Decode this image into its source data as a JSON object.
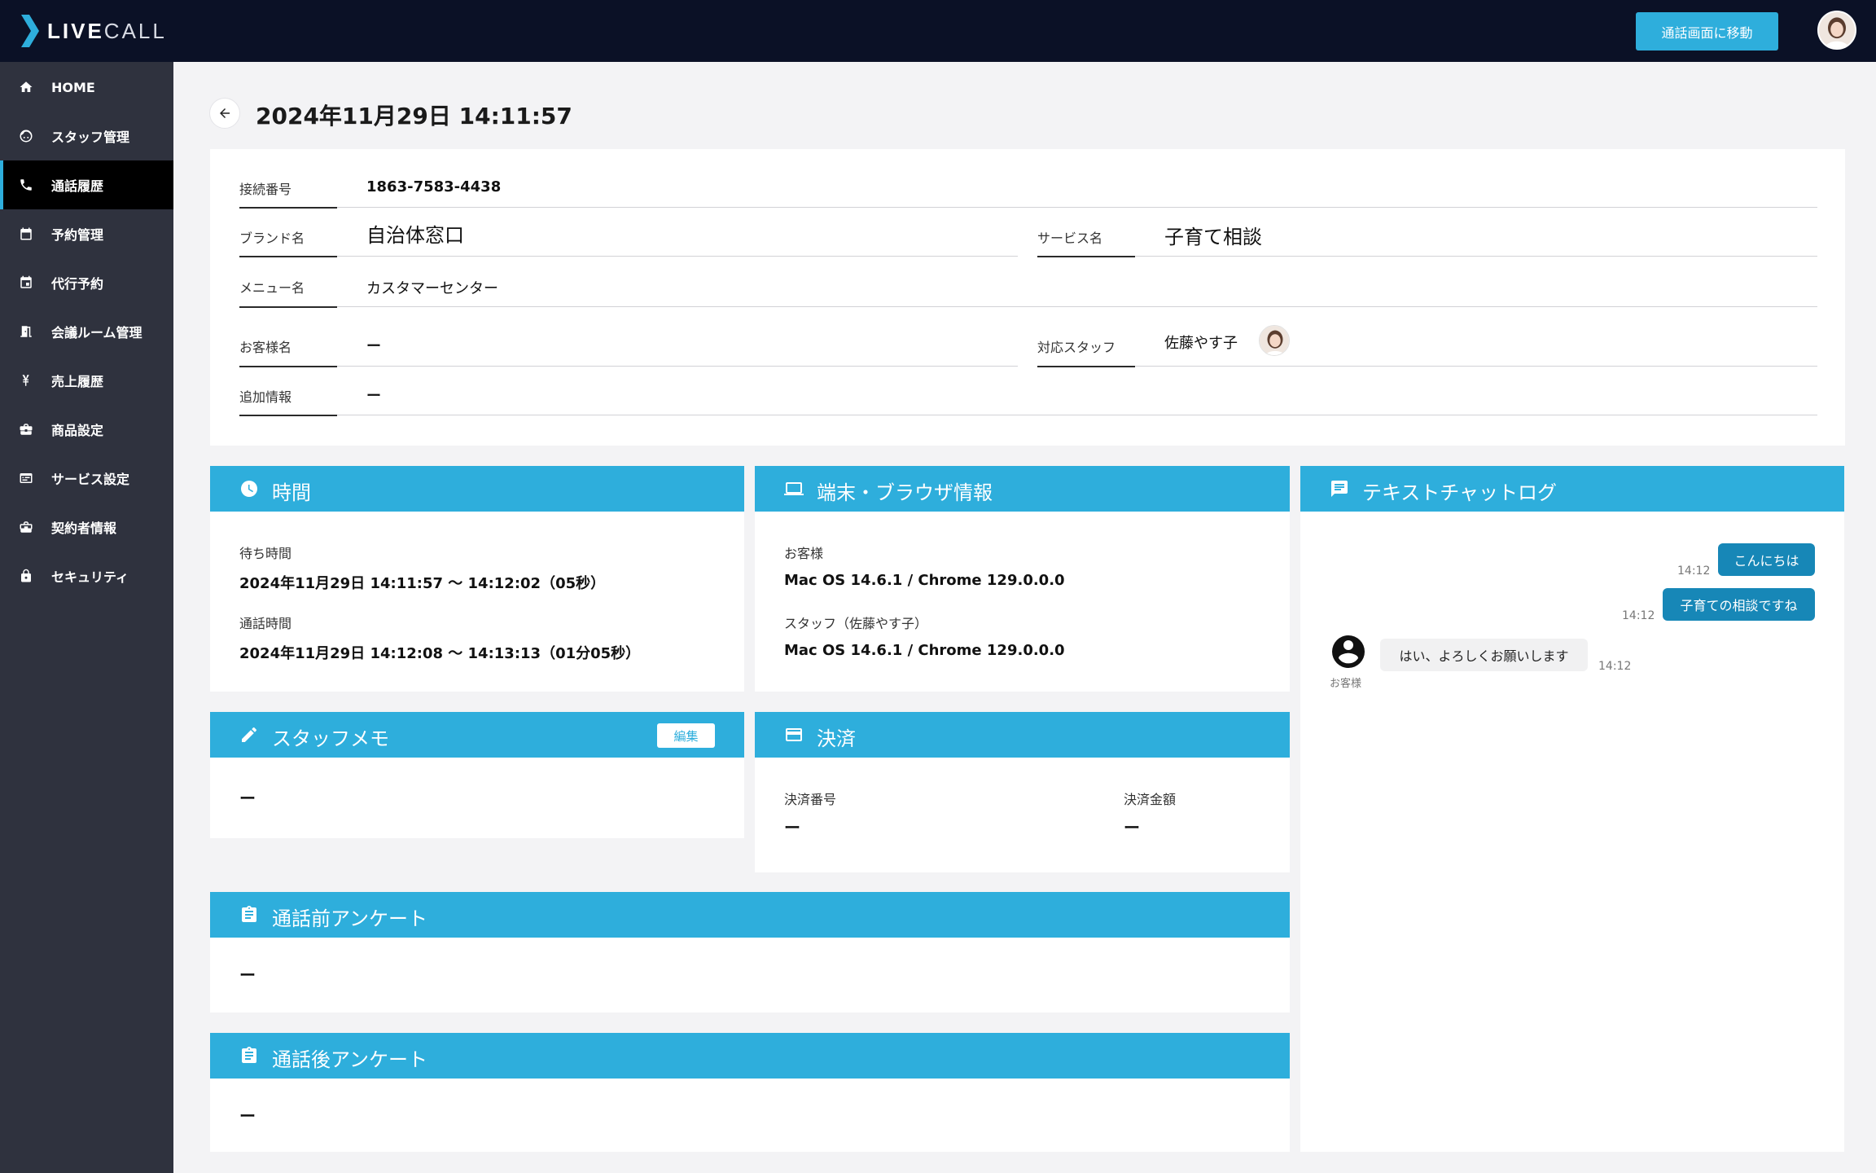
{
  "app": {
    "logo_live": "LIVE",
    "logo_call": "CALL",
    "call_button": "通話画面に移動"
  },
  "sidebar": {
    "items": [
      {
        "label": "HOME",
        "icon": "home-icon"
      },
      {
        "label": "スタッフ管理",
        "icon": "staff-face-icon"
      },
      {
        "label": "通話履歴",
        "icon": "phone-icon",
        "active": true
      },
      {
        "label": "予約管理",
        "icon": "calendar-icon"
      },
      {
        "label": "代行予約",
        "icon": "calendar-event-icon"
      },
      {
        "label": "会議ルーム管理",
        "icon": "meeting-room-icon"
      },
      {
        "label": "売上履歴",
        "icon": "yen-icon"
      },
      {
        "label": "商品設定",
        "icon": "briefcase-icon"
      },
      {
        "label": "サービス設定",
        "icon": "service-list-icon"
      },
      {
        "label": "契約者情報",
        "icon": "contract-icon"
      },
      {
        "label": "セキュリティ",
        "icon": "lock-icon"
      }
    ]
  },
  "page": {
    "title": "2024年11月29日 14:11:57"
  },
  "info": {
    "connection_label": "接続番号",
    "connection_value": "1863-7583-4438",
    "brand_label": "ブランド名",
    "brand_value": "自治体窓口",
    "service_label": "サービス名",
    "service_value": "子育て相談",
    "menu_label": "メニュー名",
    "menu_value": "カスタマーセンター",
    "customer_label": "お客様名",
    "customer_value": "ー",
    "staff_label": "対応スタッフ",
    "staff_value": "佐藤やす子",
    "extra_label": "追加情報",
    "extra_value": "ー"
  },
  "time_panel": {
    "title": "時間",
    "wait_label": "待ち時間",
    "wait_value": "2024年11月29日 14:11:57 〜 14:12:02（05秒）",
    "call_label": "通話時間",
    "call_value": "2024年11月29日 14:12:08 〜 14:13:13（01分05秒）"
  },
  "device_panel": {
    "title": "端末・ブラウザ情報",
    "customer_label": "お客様",
    "customer_value": "Mac OS 14.6.1 / Chrome 129.0.0.0",
    "staff_label": "スタッフ（佐藤やす子）",
    "staff_value": "Mac OS 14.6.1 / Chrome 129.0.0.0"
  },
  "chat_panel": {
    "title": "テキストチャットログ",
    "messages": [
      {
        "text": "こんにちは",
        "time": "14:12",
        "from": "staff"
      },
      {
        "text": "子育ての相談ですね",
        "time": "14:12",
        "from": "staff"
      },
      {
        "text": "はい、よろしくお願いします",
        "time": "14:12",
        "from": "customer",
        "sender": "お客様"
      }
    ]
  },
  "memo_panel": {
    "title": "スタッフメモ",
    "edit_label": "編集",
    "value": "ー"
  },
  "payment_panel": {
    "title": "決済",
    "number_label": "決済番号",
    "number_value": "ー",
    "amount_label": "決済金額",
    "amount_value": "ー"
  },
  "pre_survey": {
    "title": "通話前アンケート",
    "value": "ー"
  },
  "post_survey": {
    "title": "通話後アンケート",
    "value": "ー"
  },
  "colors": {
    "accent": "#2eaedc",
    "topbar": "#0b1126",
    "sidebar": "#2f323e",
    "chat_bubble": "#1787b7"
  }
}
